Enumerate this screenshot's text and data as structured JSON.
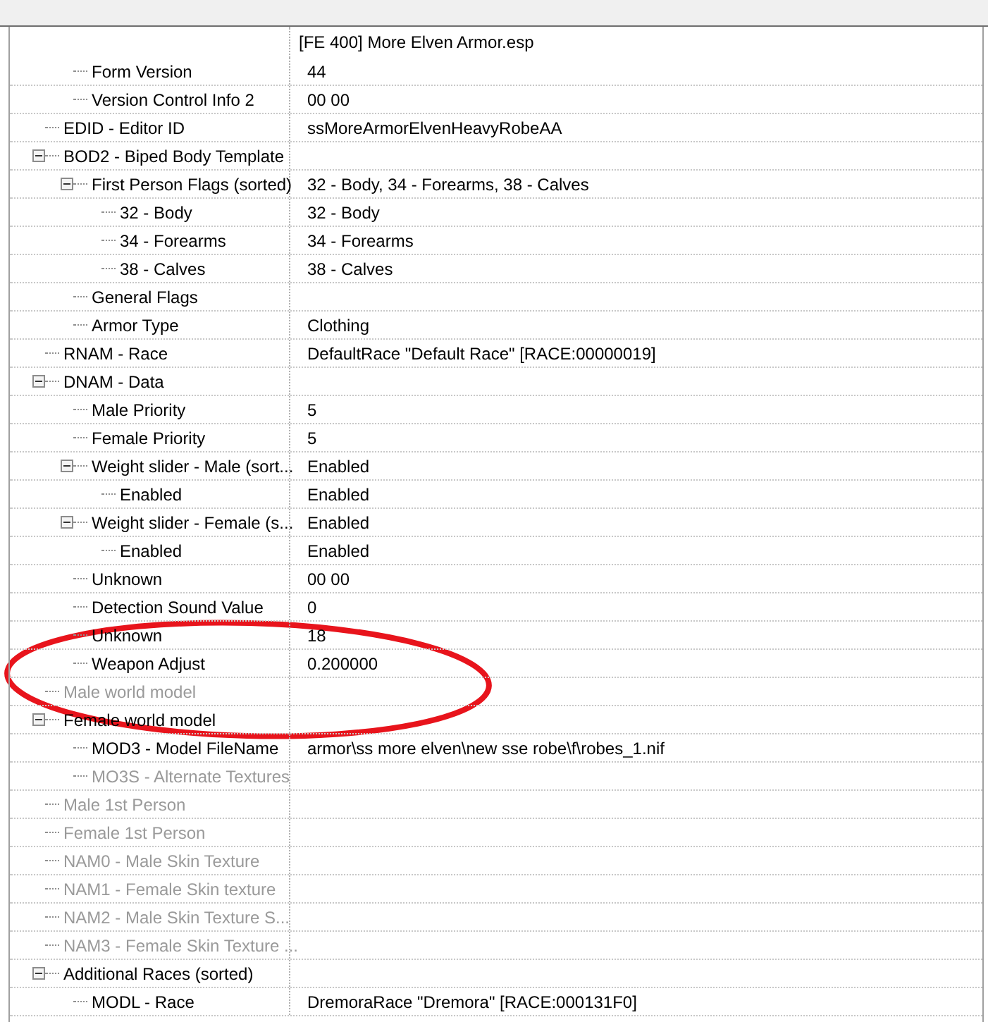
{
  "header": {
    "file": "[FE 400] More Elven Armor.esp"
  },
  "continued_rows": [
    {
      "label": "Form Version",
      "value": "44",
      "empty": false
    },
    {
      "label": "Version Control Info 2",
      "value": "00 00",
      "empty": false
    }
  ],
  "rows": [
    {
      "label": "EDID - Editor ID",
      "value": "ssMoreArmorElvenHeavyRobeAA",
      "empty": false
    },
    {
      "label": "BOD2 - Biped Body Template",
      "empty": false,
      "expanded": true,
      "children": [
        {
          "label": "First Person Flags (sorted)",
          "value": "32 - Body, 34 - Forearms, 38 - Calves",
          "empty": false,
          "expanded": true,
          "children": [
            {
              "label": "32 - Body",
              "value": "32 - Body",
              "empty": false
            },
            {
              "label": "34 - Forearms",
              "value": "34 - Forearms",
              "empty": false
            },
            {
              "label": "38 - Calves",
              "value": "38 - Calves",
              "empty": false
            }
          ]
        },
        {
          "label": "General Flags",
          "empty": false
        },
        {
          "label": "Armor Type",
          "value": "Clothing",
          "empty": false
        }
      ]
    },
    {
      "label": "RNAM - Race",
      "value": "DefaultRace \"Default Race\" [RACE:00000019]",
      "empty": false
    },
    {
      "label": "DNAM - Data",
      "empty": false,
      "expanded": true,
      "children": [
        {
          "label": "Male Priority",
          "value": "5",
          "empty": false
        },
        {
          "label": "Female Priority",
          "value": "5",
          "empty": false
        },
        {
          "label": "Weight slider - Male (sort...",
          "value": "Enabled",
          "empty": false,
          "expanded": true,
          "children": [
            {
              "label": "Enabled",
              "value": "Enabled",
              "empty": false
            }
          ]
        },
        {
          "label": "Weight slider - Female (s...",
          "value": "Enabled",
          "empty": false,
          "expanded": true,
          "children": [
            {
              "label": "Enabled",
              "value": "Enabled",
              "empty": false
            }
          ]
        },
        {
          "label": "Unknown",
          "value": "00 00",
          "empty": false
        },
        {
          "label": "Detection Sound Value",
          "value": "0",
          "empty": false
        },
        {
          "label": "Unknown",
          "value": "18",
          "empty": false
        },
        {
          "label": "Weapon Adjust",
          "value": "0.200000",
          "empty": false
        }
      ]
    },
    {
      "label": "Male world model",
      "empty": true
    },
    {
      "label": "Female world model",
      "empty": false,
      "expanded": true,
      "children": [
        {
          "label": "MOD3 - Model FileName",
          "value": "armor\\ss more elven\\new sse robe\\f\\robes_1.nif",
          "empty": false
        },
        {
          "label": "MO3S - Alternate Textures",
          "empty": true
        }
      ]
    },
    {
      "label": "Male 1st Person",
      "empty": true
    },
    {
      "label": "Female 1st Person",
      "empty": true
    },
    {
      "label": "NAM0 - Male Skin Texture",
      "empty": true
    },
    {
      "label": "NAM1 - Female Skin texture",
      "empty": true
    },
    {
      "label": "NAM2 - Male Skin Texture S...",
      "empty": true
    },
    {
      "label": "NAM3 - Female Skin Texture ...",
      "empty": true
    },
    {
      "label": "Additional Races (sorted)",
      "empty": false,
      "expanded": true,
      "children": [
        {
          "label": "MODL - Race",
          "value": "DremoraRace \"Dremora\" [RACE:000131F0]",
          "empty": false
        }
      ]
    }
  ]
}
